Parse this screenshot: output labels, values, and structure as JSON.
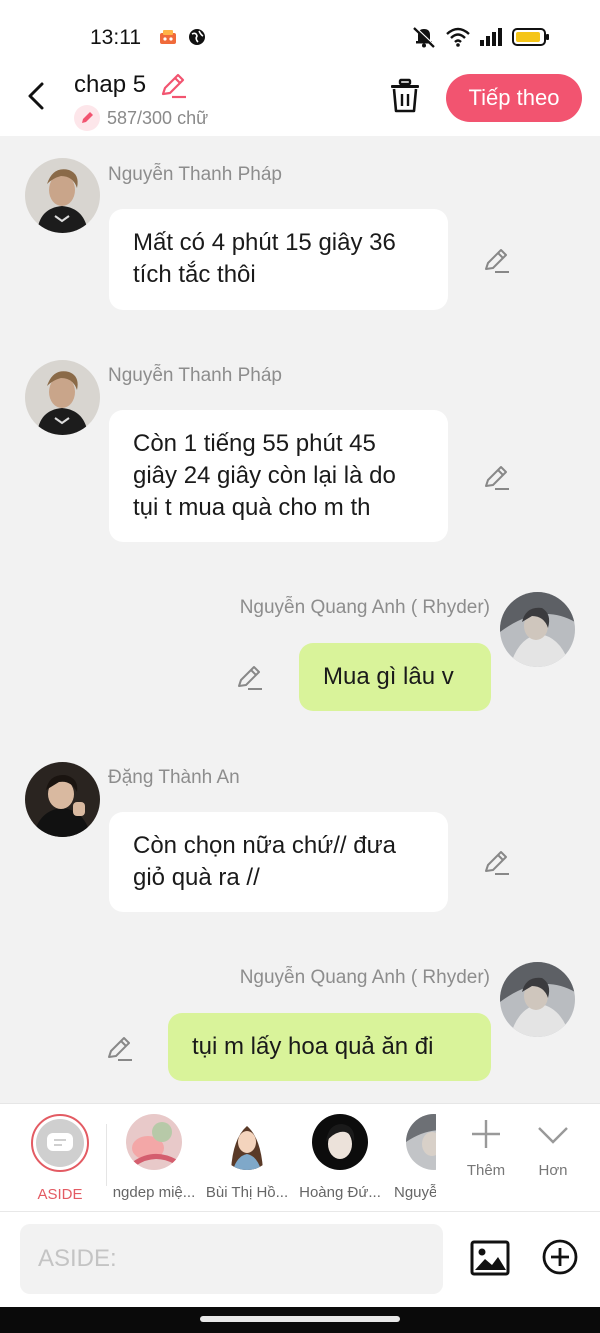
{
  "status_bar": {
    "time": "13:11"
  },
  "header": {
    "title": "chap 5",
    "word_count": "587/300 chữ",
    "next_label": "Tiếp theo"
  },
  "messages": [
    {
      "sender": "Nguyễn Thanh Pháp",
      "text": "Mất có 4 phút 15 giây 36 tích tắc thôi",
      "side": "left"
    },
    {
      "sender": "Nguyễn Thanh Pháp",
      "text": "Còn 1 tiếng 55 phút 45 giây 24 giây còn lại là do tụi t mua quà cho m th",
      "side": "left"
    },
    {
      "sender": "Nguyễn Quang Anh ( Rhyder)",
      "text": "Mua gì lâu v",
      "side": "right"
    },
    {
      "sender": "Đặng Thành An",
      "text": "Còn chọn nữa chứ// đưa giỏ quà ra //",
      "side": "left"
    },
    {
      "sender": "Nguyễn Quang Anh ( Rhyder)",
      "text": "tụi m lấy hoa quả ăn đi",
      "side": "right"
    }
  ],
  "characters": [
    {
      "label": "ASIDE",
      "selected": true
    },
    {
      "label": "ngdep miệ..."
    },
    {
      "label": "Bùi Thị Hồ..."
    },
    {
      "label": "Hoàng Đứ..."
    },
    {
      "label": "Nguyễ"
    }
  ],
  "tools": {
    "add_label": "Thêm",
    "more_label": "Hơn"
  },
  "input": {
    "placeholder": "ASIDE:",
    "value": ""
  },
  "colors": {
    "accent": "#f25470",
    "left_bubble": "#ffffff",
    "right_bubble": "#d9f39a",
    "aside_ring": "#e35b63"
  }
}
